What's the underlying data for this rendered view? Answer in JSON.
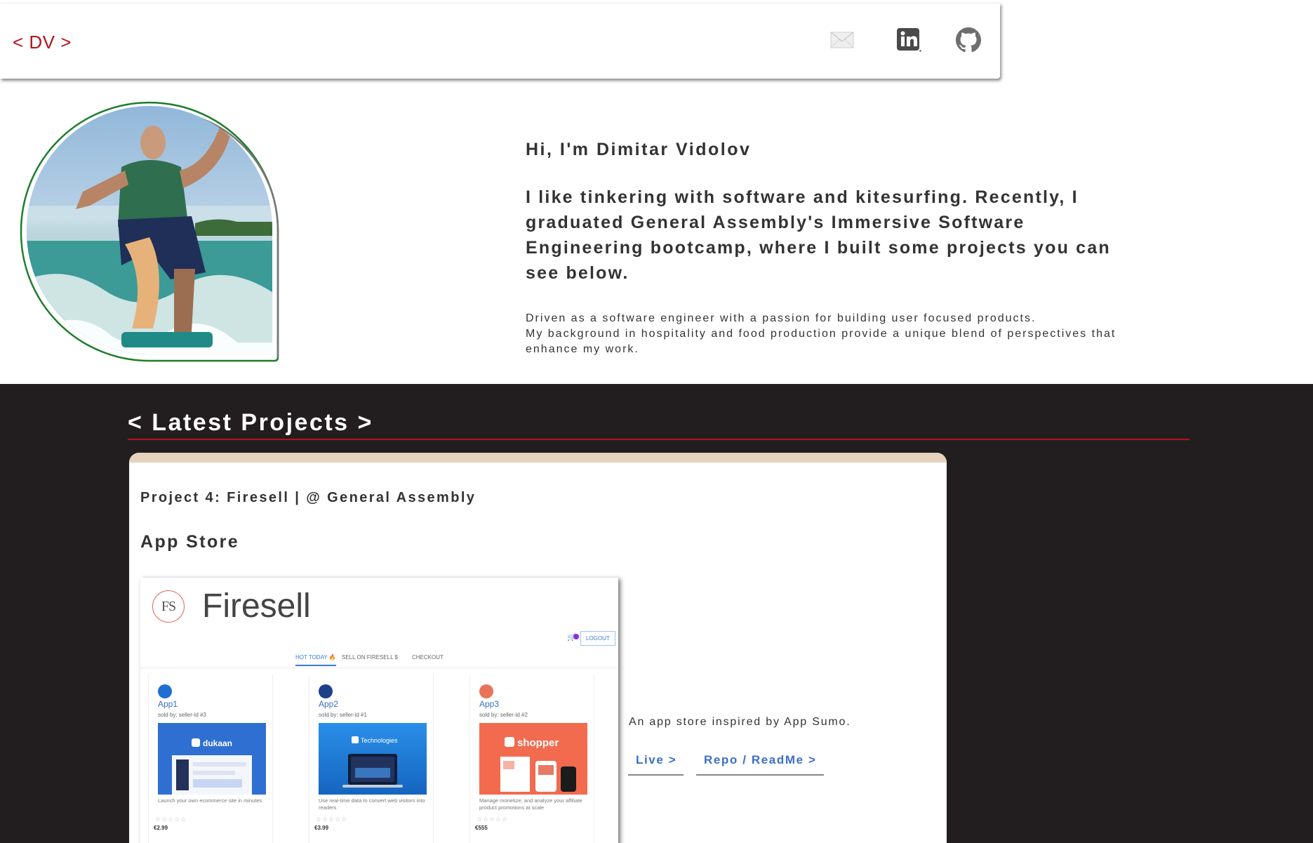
{
  "header": {
    "logo": "< DV >",
    "icons": {
      "mail": "mail-icon",
      "linkedin": "linkedin-icon",
      "github": "github-icon"
    }
  },
  "intro": {
    "greeting": "Hi, I'm Dimitar Vidolov",
    "lead": "I like tinkering with software and kitesurfing. Recently, I graduated General Assembly's Immersive Software Engineering bootcamp, where I built some projects you can see below.",
    "bio_line1": "Driven as a software engineer with a passion for building user focused products.",
    "bio_line2": "My background in hospitality and food production provide a unique blend of perspectives that enhance my work."
  },
  "projects": {
    "section_title": "< Latest Projects >",
    "card": {
      "title": "Project 4: Firesell | @ General Assembly",
      "subtitle": "App Store",
      "description": "An app store inspired by App Sumo.",
      "live_label": "Live >",
      "repo_label": "Repo / ReadMe >",
      "screenshot": {
        "logo_initials": "FS",
        "brand": "Firesell",
        "cart_count": "2",
        "logout_label": "LOGOUT",
        "tabs": [
          "HOT TODAY 🔥",
          "SELL ON FIRESELL $",
          "CHECKOUT"
        ],
        "products": [
          {
            "name": "App1",
            "seller": "sold by: seller-id #3",
            "image_label": "dukaan",
            "desc": "Launch your own ecommerce site in minutes",
            "stars": "☆☆☆☆☆",
            "price": "€2.99"
          },
          {
            "name": "App2",
            "seller": "sold by: seller-id #1",
            "image_label": "Technologies",
            "desc": "Use real-time data to convert web visitors into readers",
            "stars": "☆☆☆☆☆",
            "price": "€3.99"
          },
          {
            "name": "App3",
            "seller": "sold by: seller-id #2",
            "image_label": "shopper",
            "desc": "Manage monetize, and analyze your affiliate product promotions at scale",
            "stars": "☆☆☆☆☆",
            "price": "€555"
          }
        ]
      }
    }
  },
  "colors": {
    "accent_red": "#b3131b",
    "dark_bg": "#221e1f",
    "link_blue": "#3a6fc4",
    "card_top": "#e6d2bd"
  }
}
